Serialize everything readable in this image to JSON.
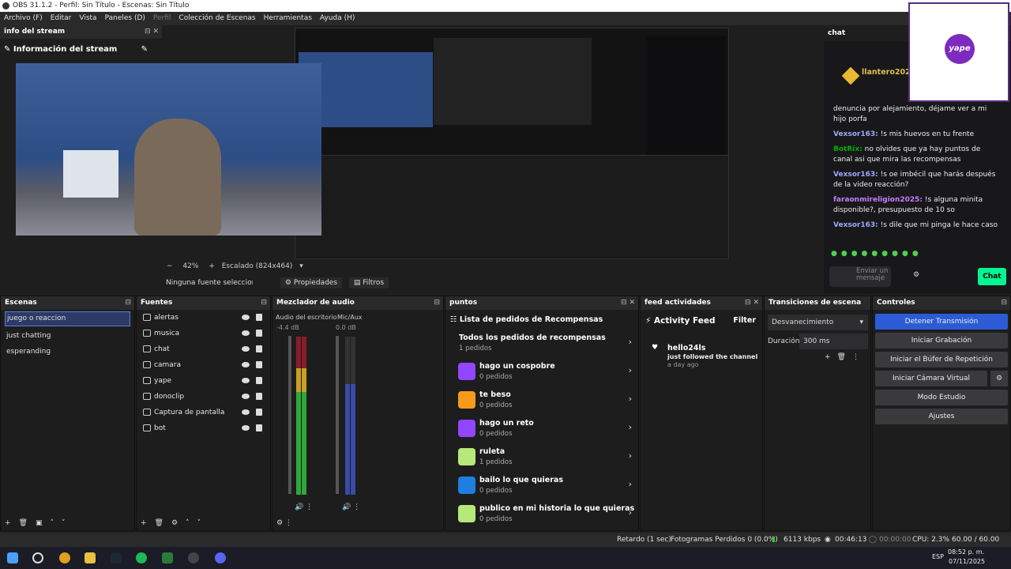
{
  "window": {
    "title": "OBS 31.1.2 - Perfil: Sin Título - Escenas: Sin Título"
  },
  "menu": {
    "items": [
      "Archivo (F)",
      "Editar",
      "Vista",
      "Paneles (D)",
      "Perfil",
      "Colección de Escenas",
      "Herramientas",
      "Ayuda (H)"
    ]
  },
  "info_dock": {
    "title": "info del stream",
    "header": "Información del stream"
  },
  "preview": {
    "zoom": "42%",
    "scale": "Escalado (824x464)",
    "no_source": "Ninguna fuente seleccionada",
    "props": "Propiedades",
    "filters": "Filtros"
  },
  "chat": {
    "title": "chat",
    "top_user": "llantero2025",
    "messages": [
      {
        "user": "",
        "text": "denuncia por alejamiento, déjame ver a mi hijo porfa"
      },
      {
        "user": "Vexsor163:",
        "text": "!s mis huevos en tu frente"
      },
      {
        "user": "BotRix:",
        "text": "no olvides que ya hay puntos de canal asi que mira las recompensas"
      },
      {
        "user": "Vexsor163:",
        "text": "!s oe imbécil que harás después de la video reacción?"
      },
      {
        "user": "faraonmireligion2025:",
        "text": "!s alguna minita disponible?, presupuesto de 10 so"
      },
      {
        "user": "Vexsor163:",
        "text": "!s dile que mi pinga le hace caso"
      }
    ],
    "input_placeholder": "Enviar un mensaje",
    "chat_button": "Chat",
    "qr_label": "yape"
  },
  "scenes": {
    "title": "Escenas",
    "items": [
      "juego o reaccion",
      "just chatting",
      "esperanding"
    ]
  },
  "sources": {
    "title": "Fuentes",
    "items": [
      "alertas",
      "musica",
      "chat",
      "camara",
      "yape",
      "donoclip",
      "Captura de pantalla",
      "bot"
    ]
  },
  "mixer": {
    "title": "Mezclador de audio",
    "channels": [
      {
        "name": "Audio del escritorio",
        "db": "-4.4 dB",
        "level": 0.82
      },
      {
        "name": "Mic/Aux",
        "db": "0.0 dB",
        "level": 0.95
      }
    ],
    "scale": [
      "0",
      "-5",
      "-10",
      "-15",
      "-20",
      "-25",
      "-30",
      "-35",
      "-40",
      "-45",
      "-50",
      "-55",
      "-60"
    ]
  },
  "points": {
    "title": "puntos",
    "header": "Lista de pedidos de Recompensas",
    "all": {
      "title": "Todos los pedidos de recompensas",
      "count": "1 pedidos"
    },
    "rewards": [
      {
        "title": "hago un cospobre",
        "count": "0 pedidos",
        "color": "#9146ff"
      },
      {
        "title": "te beso",
        "count": "0 pedidos",
        "color": "#f59a1a"
      },
      {
        "title": "hago un reto",
        "count": "0 pedidos",
        "color": "#9146ff"
      },
      {
        "title": "ruleta",
        "count": "1 pedidos",
        "color": "#b7e87a"
      },
      {
        "title": "bailo lo que quieras",
        "count": "0 pedidos",
        "color": "#1f7fe0"
      },
      {
        "title": "publico en mi historia lo que quieras",
        "count": "0 pedidos",
        "color": "#b7e87a"
      }
    ]
  },
  "feed": {
    "title": "feed actividades",
    "header": "Activity Feed",
    "filter": "Filter",
    "user": "hello24ls",
    "event": "just followed the channel",
    "time": "a day ago"
  },
  "transitions": {
    "title": "Transiciones de escena",
    "selected": "Desvanecimiento",
    "duration_label": "Duración",
    "duration": "300 ms"
  },
  "controls": {
    "title": "Controles",
    "buttons": [
      "Detener Transmisión",
      "Iniciar Grabación",
      "Iniciar el Búfer de Repetición",
      "Iniciar Cámara Virtual",
      "Modo Estudio",
      "Ajustes"
    ]
  },
  "status": {
    "delay": "Retardo (1 sec)",
    "dropped": "Fotogramas Perdidos 0 (0.0%)",
    "bitrate": "6113 kbps",
    "live": "00:46:13",
    "rec": "00:00:00",
    "cpu": "CPU: 2.3%",
    "fps": "60.00 / 60.00 FPS"
  },
  "taskbar": {
    "lang": "ESP",
    "time": "08:52 p. m.",
    "date": "07/11/2025"
  },
  "colors": {
    "accent": "#2c5bd6",
    "twitch": "#9146ff",
    "chat_btn": "#00f593"
  }
}
